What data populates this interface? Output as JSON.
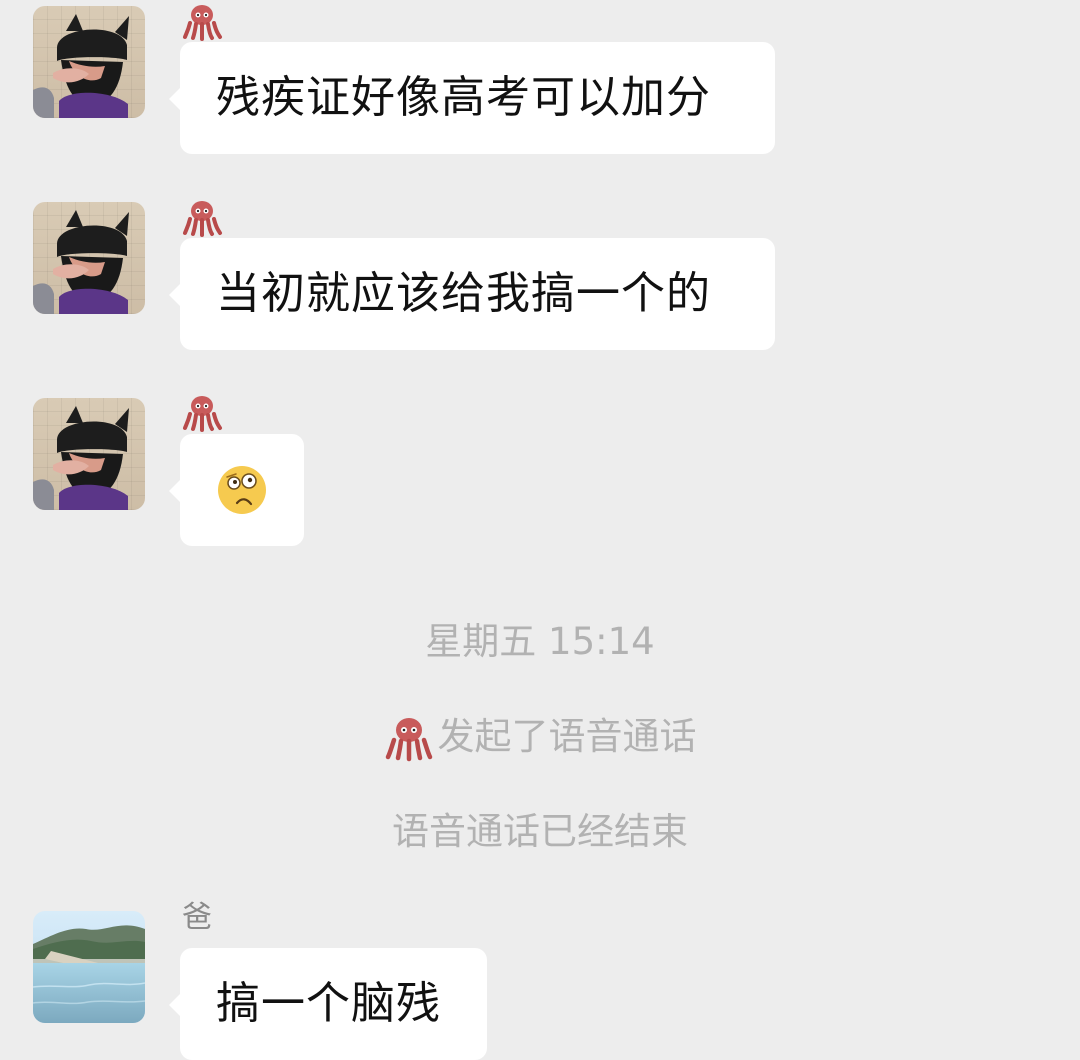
{
  "chat": {
    "messages": [
      {
        "avatar": "helmet-avatar",
        "sender_icon": "octopus-icon",
        "text": "残疾证好像高考可以加分"
      },
      {
        "avatar": "helmet-avatar",
        "sender_icon": "octopus-icon",
        "text": "当初就应该给我搞一个的"
      },
      {
        "avatar": "helmet-avatar",
        "sender_icon": "octopus-icon",
        "emoji": "thinking-face-icon"
      },
      {
        "avatar": "landscape-avatar",
        "sender": "爸",
        "text": "搞一个脑残"
      }
    ],
    "system": {
      "timestamp": "星期五 15:14",
      "call_started": "发起了语音通话",
      "call_ended": "语音通话已经结束"
    }
  },
  "colors": {
    "background": "#ededed",
    "bubble": "#ffffff",
    "message_text": "#111111",
    "system_text": "#b2b2b2",
    "sender_text": "#8a8a8a"
  }
}
